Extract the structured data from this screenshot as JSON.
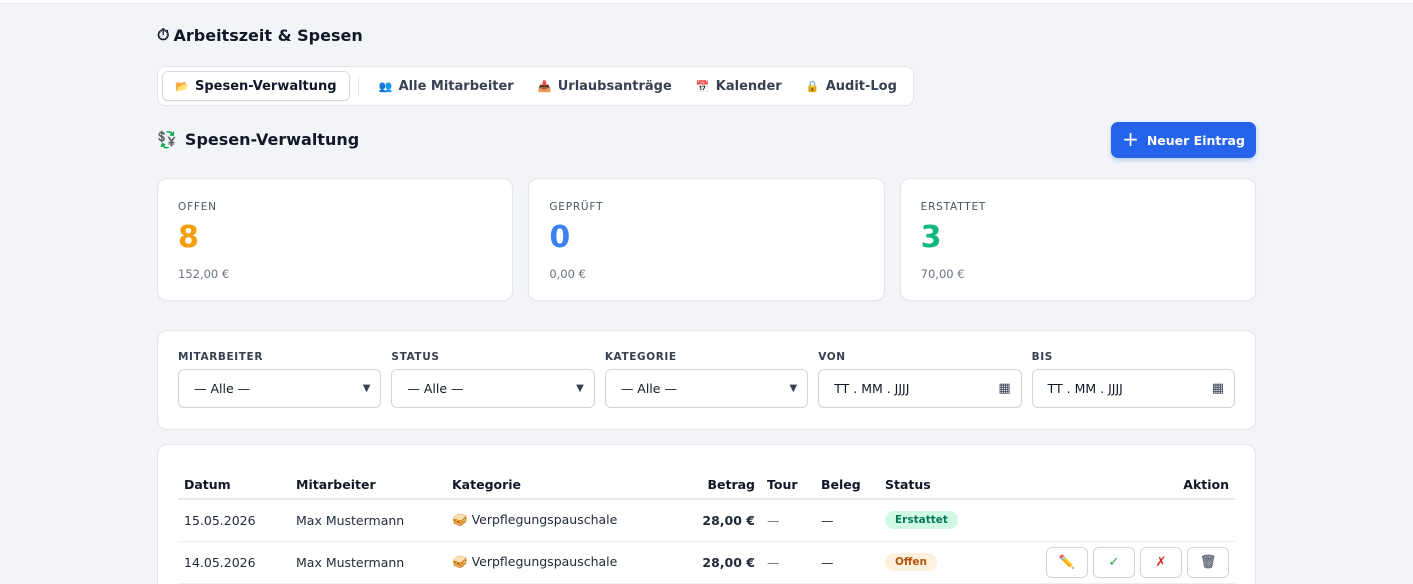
{
  "app": {
    "icon": "⏱",
    "title": "Arbeitszeit & Spesen"
  },
  "tabs": [
    {
      "icon": "📂",
      "label": "Spesen-Verwaltung",
      "active": true
    },
    {
      "icon": "👥",
      "label": "Alle Mitarbeiter"
    },
    {
      "icon": "📥",
      "label": "Urlaubsanträge"
    },
    {
      "icon": "📅",
      "label": "Kalender"
    },
    {
      "icon": "🔒",
      "label": "Audit-Log"
    }
  ],
  "section": {
    "icon": "💱",
    "title": "Spesen-Verwaltung"
  },
  "new_button": {
    "label": "Neuer Eintrag",
    "icon": "+"
  },
  "stats": [
    {
      "label": "OFFEN",
      "value": "8",
      "sub": "152,00 €",
      "color": "#f59e0b"
    },
    {
      "label": "GEPRÜFT",
      "value": "0",
      "sub": "0,00 €",
      "color": "#3b82f6"
    },
    {
      "label": "ERSTATTET",
      "value": "3",
      "sub": "70,00 €",
      "color": "#10b981"
    }
  ],
  "filters": [
    {
      "label": "MITARBEITER",
      "value": "— Alle —",
      "type": "select"
    },
    {
      "label": "STATUS",
      "value": "— Alle —",
      "type": "select"
    },
    {
      "label": "KATEGORIE",
      "value": "— Alle —",
      "type": "select"
    },
    {
      "label": "VON",
      "value": "TT . MM . JJJJ",
      "type": "date"
    },
    {
      "label": "BIS",
      "value": "TT . MM . JJJJ",
      "type": "date"
    }
  ],
  "table": {
    "headers": {
      "datum": "Datum",
      "mitarbeiter": "Mitarbeiter",
      "kategorie": "Kategorie",
      "betrag": "Betrag",
      "tour": "Tour",
      "beleg": "Beleg",
      "status": "Status",
      "aktion": "Aktion"
    },
    "rows": [
      {
        "datum": "15.05.2026",
        "mitarbeiter": "Max Mustermann",
        "kategorie_icon": "🥪",
        "kategorie": "Verpflegungspauschale",
        "betrag": "28,00 €",
        "tour": "—",
        "beleg": "—",
        "status": "Erstattet"
      },
      {
        "datum": "14.05.2026",
        "mitarbeiter": "Max Mustermann",
        "kategorie_icon": "🥪",
        "kategorie": "Verpflegungspauschale",
        "betrag": "28,00 €",
        "tour": "—",
        "beleg": "—",
        "status": "Offen"
      }
    ],
    "action_icons": {
      "edit": "✏️",
      "approve": "✓",
      "reject": "✗",
      "delete": "🗑"
    }
  },
  "icons": {
    "chevron": "chevron-down-icon",
    "calendar": "calendar-icon"
  }
}
